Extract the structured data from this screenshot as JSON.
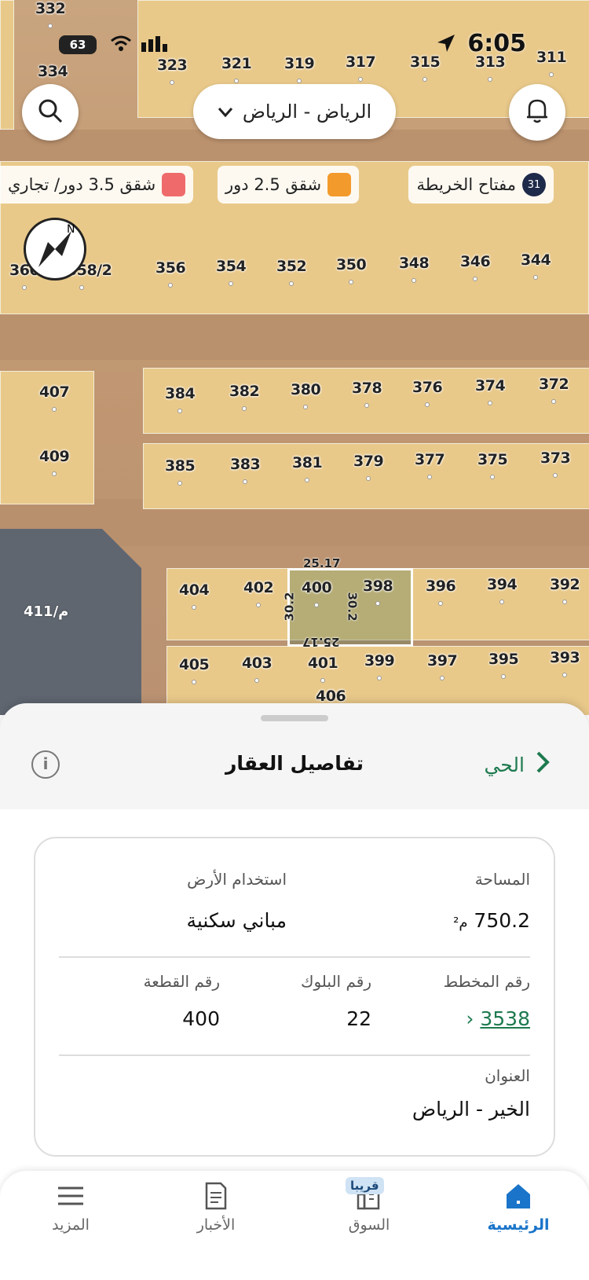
{
  "status_bar": {
    "time": "6:05",
    "battery": "63"
  },
  "map": {
    "city_selector": "الرياض - الرياض",
    "legend": [
      {
        "label": "مفتاح الخريطة",
        "badge": "31"
      },
      {
        "label": "شقق 2.5 دور",
        "color": "#f39a2c"
      },
      {
        "label": "شقق 3.5 دور/ تجاري",
        "color": "#ef6b6b"
      }
    ],
    "compass_label": "N",
    "parcels": [
      "332",
      "334",
      "323",
      "321",
      "319",
      "317",
      "315",
      "313",
      "311",
      "360",
      "358/2",
      "356",
      "354",
      "352",
      "350",
      "348",
      "346",
      "344",
      "407",
      "384",
      "382",
      "380",
      "378",
      "376",
      "374",
      "372",
      "409",
      "385",
      "383",
      "381",
      "379",
      "377",
      "375",
      "373",
      "404",
      "402",
      "400",
      "398",
      "396",
      "394",
      "392",
      "405",
      "403",
      "401",
      "399",
      "397",
      "395",
      "393",
      "406"
    ],
    "zone_label": "411/م",
    "selected_dims": {
      "top": "25.17",
      "bottom": "25.17",
      "left": "30.2",
      "right": "30.2"
    }
  },
  "sheet": {
    "title": "تفاصيل العقار",
    "back_label": "الحي",
    "area": {
      "label": "المساحة",
      "value": "750.2",
      "unit": "م²"
    },
    "land_use": {
      "label": "استخدام الأرض",
      "value": "مباني سكنية"
    },
    "plan": {
      "label": "رقم المخطط",
      "value": "3538"
    },
    "block": {
      "label": "رقم البلوك",
      "value": "22"
    },
    "plot": {
      "label": "رقم القطعة",
      "value": "400"
    },
    "address": {
      "label": "العنوان",
      "value": "الخير - الرياض"
    }
  },
  "tabs": [
    {
      "label": "الرئيسية",
      "active": true
    },
    {
      "label": "السوق",
      "badge": "قريبا"
    },
    {
      "label": "الأخبار"
    },
    {
      "label": "المزيد"
    }
  ],
  "colors": {
    "accent": "#1d7a4f",
    "active_tab": "#1a74c9"
  }
}
